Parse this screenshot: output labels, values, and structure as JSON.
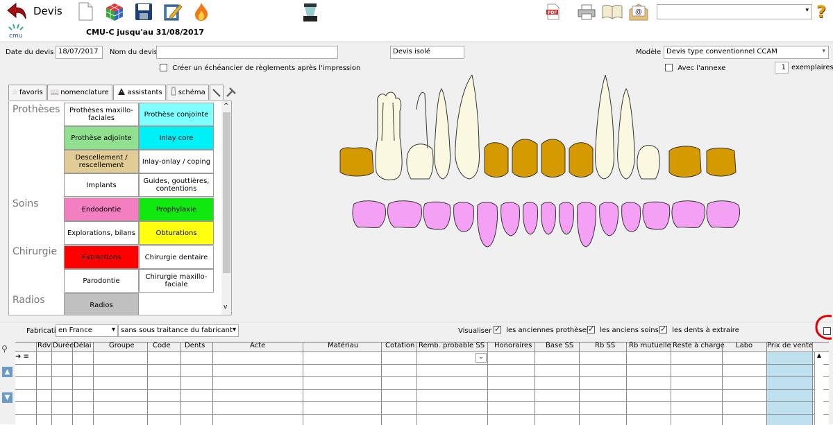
{
  "toolbar": {
    "title": "Devis",
    "cmu_text": "CMU-C jusqu'au 31/08/2017",
    "cmu_logo": "cmu",
    "pdf_label": "PDF",
    "right_combo_value": "",
    "help_glyph": "?"
  },
  "header": {
    "date_label": "Date du devis :",
    "date_value": "18/07/2017",
    "name_label": "Nom du devis",
    "name_value": "",
    "type_value": "Devis isolé",
    "model_label": "Modèle",
    "model_value": "Devis type conventionnel CCAM",
    "schedule_label": "Créer un échéancier de règlements après l'impression",
    "annex_label": "Avec l'annexe",
    "copies_value": "1",
    "copies_label": "exemplaires"
  },
  "tabs": [
    {
      "label": "favoris",
      "icon": "star-icon"
    },
    {
      "label": "nomenclature",
      "icon": "book-icon"
    },
    {
      "label": "assistants",
      "icon": "wizard-icon"
    },
    {
      "label": "schéma",
      "icon": "tooth-icon"
    }
  ],
  "categories": [
    "Prothèses",
    "Soins",
    "Chirurgie",
    "Radios"
  ],
  "cells": [
    {
      "label": "Prothèses maxillo-faciales",
      "color": "#ffffff"
    },
    {
      "label": "Prothèse conjointe",
      "color": "#7fffff"
    },
    {
      "label": "Prothèse adjointe",
      "color": "#90e090"
    },
    {
      "label": "Inlay core",
      "color": "#00f0f8"
    },
    {
      "label": "Descellement / rescellement",
      "color": "#e2cc95"
    },
    {
      "label": "Inlay-onlay / coping",
      "color": "#ffffff"
    },
    {
      "label": "Implants",
      "color": "#ffffff"
    },
    {
      "label": "Guides, gouttières, contentions",
      "color": "#ffffff"
    },
    {
      "label": "Endodontie",
      "color": "#f47fc0"
    },
    {
      "label": "Prophylaxie",
      "color": "#10e810"
    },
    {
      "label": "Explorations, bilans",
      "color": "#ffffff"
    },
    {
      "label": "Obturations",
      "color": "#ffff10"
    },
    {
      "label": "Extractions",
      "color": "#ff0000"
    },
    {
      "label": "Chirurgie dentaire",
      "color": "#ffffff"
    },
    {
      "label": "Parodontie",
      "color": "#ffffff"
    },
    {
      "label": "Chirurgie maxillo-faciale",
      "color": "#ffffff"
    },
    {
      "label": "Radios",
      "color": "#c0c0c0"
    }
  ],
  "fabrication": {
    "label": "Fabrication",
    "origin_value": "en France",
    "subcontract_value": "sans sous traitance du fabricant"
  },
  "visualiser": {
    "label": "Visualiser",
    "options": [
      "les anciennes prothèses",
      "les anciens soins",
      "les dents à extraire"
    ]
  },
  "table": {
    "columns": [
      "Rdv",
      "Durée",
      "Délai",
      "Groupe",
      "Code",
      "Dents",
      "Acte",
      "Matériau",
      "Cotation",
      "Remb. probable SS",
      "Honoraires",
      "Base SS",
      "Rb SS",
      "Rb mutuelle",
      "Reste à charge",
      "Labo",
      "Prix de vente"
    ]
  },
  "colors": {
    "tooth_gold": "#d49a00",
    "tooth_ivory": "#fbf8e2",
    "tooth_pink": "#f4a0f4",
    "price_col": "#bfe0ee",
    "annotation_red": "#e00000"
  }
}
